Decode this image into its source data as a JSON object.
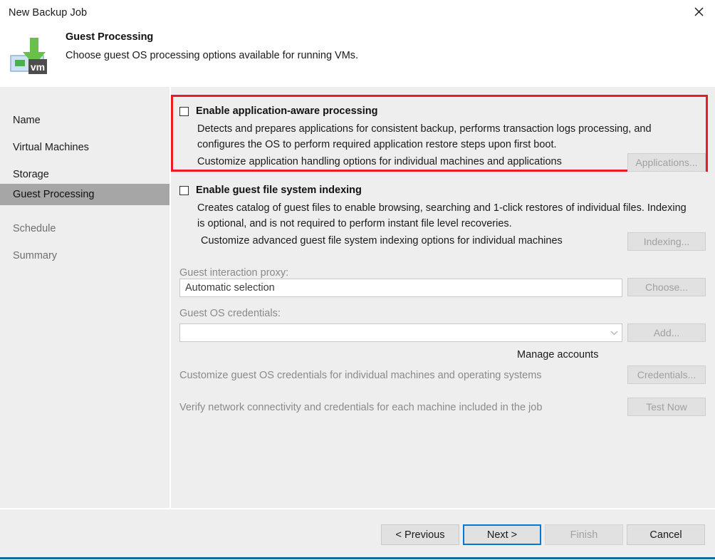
{
  "window": {
    "title": "New Backup Job",
    "close_icon": "close-icon"
  },
  "header": {
    "title": "Guest Processing",
    "subtitle": "Choose guest OS processing options available for running VMs.",
    "icon": "vm-backup-icon"
  },
  "sidebar": {
    "items": [
      {
        "label": "Name",
        "state": "normal"
      },
      {
        "label": "Virtual Machines",
        "state": "normal"
      },
      {
        "label": "Storage",
        "state": "normal"
      },
      {
        "label": "Guest Processing",
        "state": "selected"
      },
      {
        "label": "Schedule",
        "state": "disabled"
      },
      {
        "label": "Summary",
        "state": "disabled"
      }
    ]
  },
  "main": {
    "app_aware": {
      "checkbox_label": "Enable application-aware processing",
      "checked": false,
      "description": "Detects and prepares applications for consistent backup, performs transaction logs processing, and configures the OS to perform required application restore steps upon first boot.",
      "customize_text": "Customize application handling options for individual machines and applications",
      "button_label": "Applications...",
      "button_enabled": false,
      "highlight_color": "#ed1c24"
    },
    "indexing": {
      "checkbox_label": "Enable guest file system indexing",
      "checked": false,
      "description": "Creates catalog of guest files to enable browsing, searching and 1-click restores of individual files. Indexing is optional, and is not required to perform instant file level recoveries.",
      "customize_text": "Customize advanced guest file system indexing options for individual machines",
      "button_label": "Indexing...",
      "button_enabled": false
    },
    "proxy": {
      "label": "Guest interaction proxy:",
      "value": "Automatic selection",
      "button_label": "Choose...",
      "button_enabled": false
    },
    "credentials": {
      "label": "Guest OS credentials:",
      "value": "",
      "dropdown_icon": "chevron-down-icon",
      "button_label": "Add...",
      "button_enabled": false,
      "manage_accounts_link": "Manage accounts"
    },
    "customize_credentials": {
      "text": "Customize guest OS credentials for individual machines and operating systems",
      "button_label": "Credentials...",
      "button_enabled": false
    },
    "test": {
      "text": "Verify network connectivity and credentials for each machine included in the job",
      "button_label": "Test Now",
      "button_enabled": false
    }
  },
  "footer": {
    "previous_label": "< Previous",
    "next_label": "Next >",
    "finish_label": "Finish",
    "cancel_label": "Cancel",
    "accent_color": "#0e6d93"
  }
}
